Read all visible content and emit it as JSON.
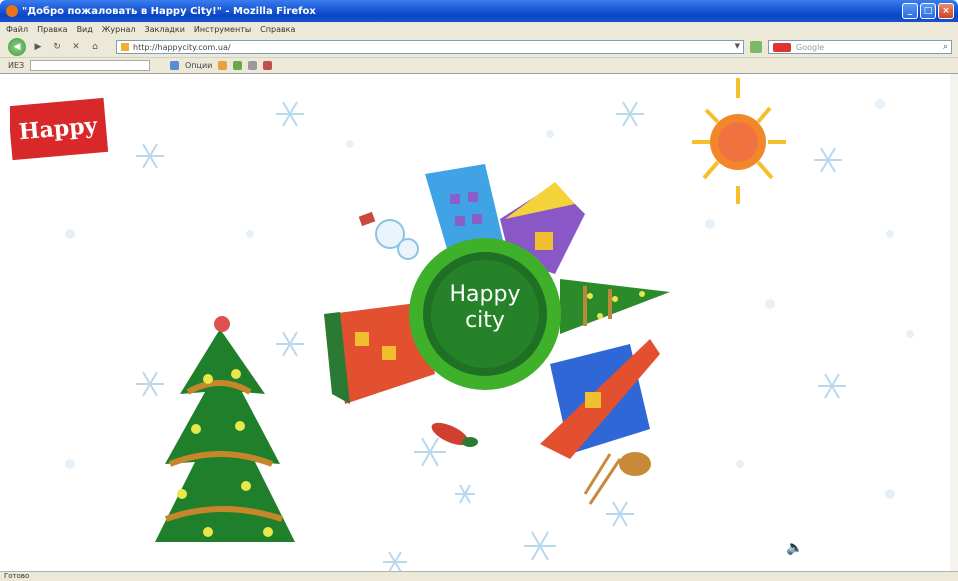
{
  "window": {
    "title": "\"Добро пожаловать в Happy City!\" - Mozilla Firefox",
    "minimize_label": "_",
    "maximize_label": "□",
    "close_label": "×"
  },
  "menu": [
    "Файл",
    "Правка",
    "Вид",
    "Журнал",
    "Закладки",
    "Инструменты",
    "Справка"
  ],
  "nav": {
    "back_glyph": "◀",
    "forward_glyph": "▶",
    "reload_glyph": "↻",
    "stop_glyph": "✕",
    "home_glyph": "⌂",
    "url": "http://happycity.com.ua/",
    "search_placeholder": "Google"
  },
  "toolbar2": {
    "label": "ИЕЗ",
    "page_label": "Опции"
  },
  "page": {
    "logo_text": "Happy",
    "planet_text_line1": "Happy",
    "planet_text_line2": "city",
    "sound_glyph": "🔈"
  },
  "status": {
    "text": "Готово"
  },
  "colors": {
    "titlebar": "#0a46c7",
    "planet": "#2f9a28",
    "logo": "#d8282a",
    "sun": "#f29a22",
    "snowflake": "#b8d8ee"
  },
  "icons": [
    "back-icon",
    "forward-icon",
    "reload-icon",
    "stop-icon",
    "home-icon",
    "search-icon",
    "sound-icon",
    "sun-icon",
    "snowflake-icon",
    "tree-icon",
    "snowman-icon"
  ]
}
